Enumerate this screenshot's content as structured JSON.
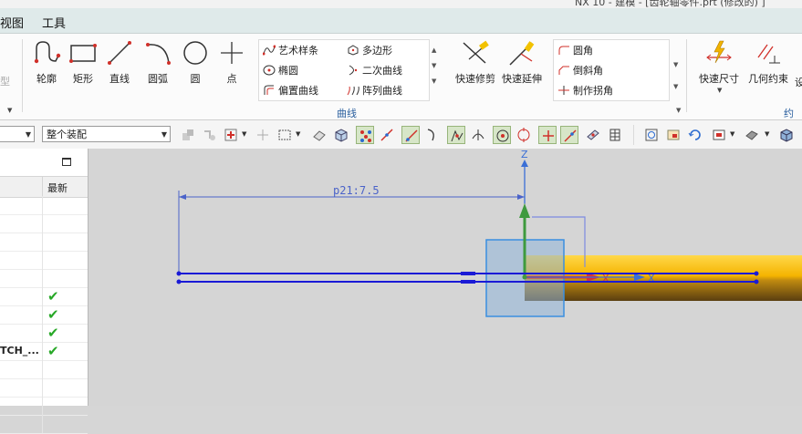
{
  "window": {
    "title_fragment": "NX 10 - 建模 - [齿轮轴零件.prt (修改的) ]"
  },
  "menubar": {
    "items": [
      {
        "label": "视图"
      },
      {
        "label": "工具"
      }
    ]
  },
  "ribbon": {
    "partial_left_label": "型",
    "buttons": [
      {
        "label": "轮廓",
        "icon": "profile-icon"
      },
      {
        "label": "矩形",
        "icon": "rectangle-icon"
      },
      {
        "label": "直线",
        "icon": "line-icon"
      },
      {
        "label": "圆弧",
        "icon": "arc-icon"
      },
      {
        "label": "圆",
        "icon": "circle-icon"
      },
      {
        "label": "点",
        "icon": "point-icon"
      }
    ],
    "curve_gallery": [
      {
        "label": "艺术样条",
        "icon": "studio-spline-icon"
      },
      {
        "label": "多边形",
        "icon": "polygon-icon"
      },
      {
        "label": "椭圆",
        "icon": "ellipse-icon"
      },
      {
        "label": "二次曲线",
        "icon": "conic-icon"
      },
      {
        "label": "偏置曲线",
        "icon": "offset-curve-icon"
      },
      {
        "label": "阵列曲线",
        "icon": "pattern-curve-icon"
      }
    ],
    "edit_buttons": [
      {
        "label": "快速修剪",
        "icon": "quick-trim-icon"
      },
      {
        "label": "快速延伸",
        "icon": "quick-extend-icon"
      }
    ],
    "corner_gallery": [
      {
        "label": "圆角",
        "icon": "fillet-icon"
      },
      {
        "label": "倒斜角",
        "icon": "chamfer-icon"
      },
      {
        "label": "制作拐角",
        "icon": "make-corner-icon"
      }
    ],
    "constraint_buttons": [
      {
        "label": "快速尺寸",
        "icon": "rapid-dimension-icon"
      },
      {
        "label": "几何约束",
        "icon": "geometric-constraint-icon"
      },
      {
        "label": "设",
        "icon": "settings-partial-icon"
      }
    ],
    "group_labels": {
      "curve": "曲线",
      "constraint": "约束"
    }
  },
  "toolbar": {
    "filter_select": "",
    "scope_select": "整个装配"
  },
  "navigator": {
    "header_latest": "最新",
    "rows": [
      {
        "name": "",
        "latest": ""
      },
      {
        "name": "",
        "latest": ""
      },
      {
        "name": "",
        "latest": ""
      },
      {
        "name": "",
        "latest": ""
      },
      {
        "name": "",
        "latest": ""
      },
      {
        "name": "",
        "latest": "✔"
      },
      {
        "name": "",
        "latest": "✔"
      },
      {
        "name": "",
        "latest": "✔"
      },
      {
        "name": "TCH_...",
        "latest": "✔"
      },
      {
        "name": "",
        "latest": ""
      },
      {
        "name": "",
        "latest": ""
      },
      {
        "name": "",
        "latest": ""
      },
      {
        "name": "",
        "latest": ""
      }
    ]
  },
  "graphics": {
    "dimension_label": "p21:7.5",
    "axis_z": "Z",
    "axis_x_sketch": "X",
    "axis_x_csys": "X",
    "colors": {
      "sketch_line": "#1a1ad6",
      "dimension": "#3a55c8",
      "solid_top": "#f5b400",
      "solid_bottom": "#6b4a10",
      "z_axis": "#3e9a3e",
      "x_axis": "#d6303a"
    }
  }
}
